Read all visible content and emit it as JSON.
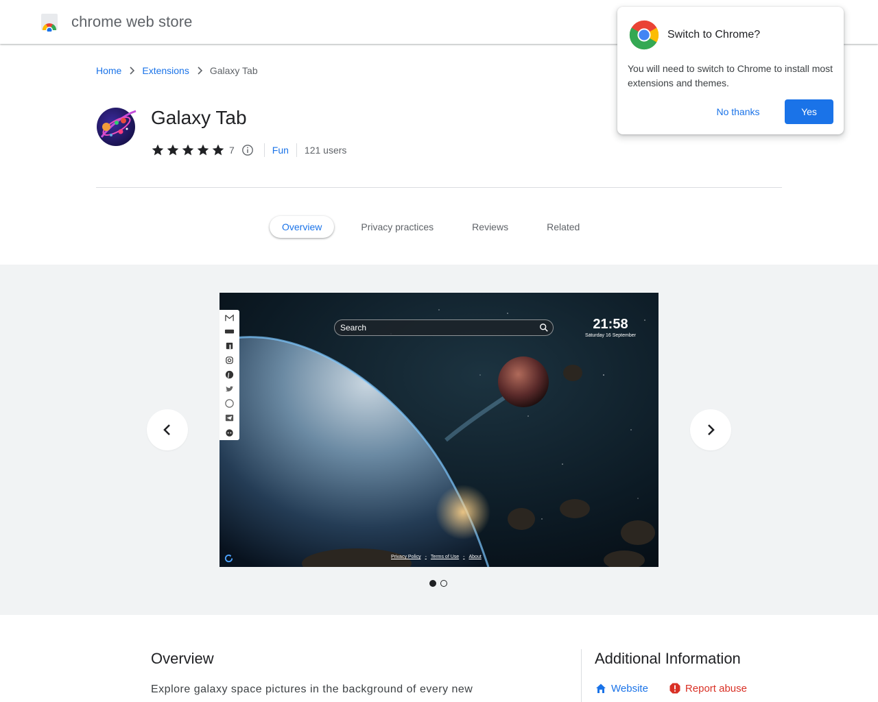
{
  "header": {
    "brand": "chrome web store"
  },
  "breadcrumb": {
    "home": "Home",
    "extensions": "Extensions",
    "current": "Galaxy Tab"
  },
  "item": {
    "title": "Galaxy Tab",
    "rating_count": "7",
    "category": "Fun",
    "users": "121 users",
    "rating_stars": 5
  },
  "tabs": [
    {
      "label": "Overview",
      "active": true
    },
    {
      "label": "Privacy practices"
    },
    {
      "label": "Reviews"
    },
    {
      "label": "Related"
    }
  ],
  "carousel": {
    "slide": 1,
    "total_slides": 2,
    "screenshot": {
      "search_placeholder": "Search",
      "time": "21:58",
      "date": "Saturday 16 September",
      "link_privacy": "Privacy Policy",
      "link_sep": "-",
      "link_terms": "Terms of Use",
      "link_about": "About"
    }
  },
  "overview": {
    "title": "Overview",
    "text": "Explore galaxy space pictures in the background of every new"
  },
  "additional": {
    "title": "Additional Information",
    "website": "Website",
    "report": "Report abuse"
  },
  "popup": {
    "title": "Switch to Chrome?",
    "body": "You will need to switch to Chrome to install most extensions and themes.",
    "no_label": "No thanks",
    "yes_label": "Yes"
  },
  "colors": {
    "accent": "#1a73e8",
    "danger": "#d93025",
    "surface": "#f1f3f4"
  }
}
